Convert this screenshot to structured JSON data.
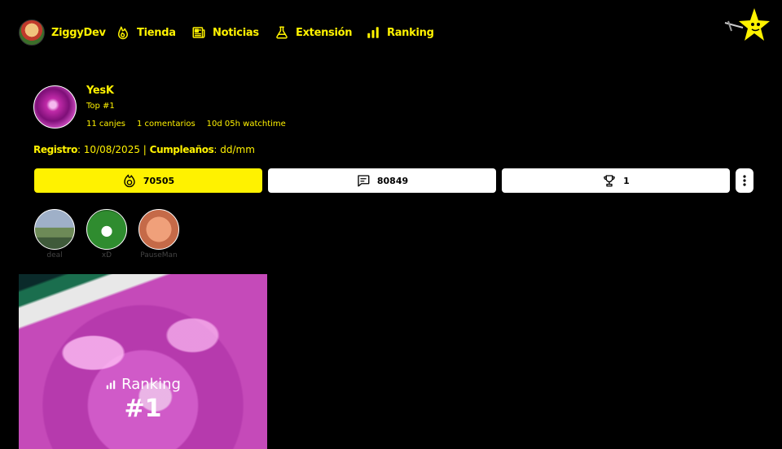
{
  "nav": {
    "user_name": "ZiggyDev",
    "items": [
      {
        "label": "Tienda",
        "icon": "fire-icon"
      },
      {
        "label": "Noticias",
        "icon": "newspaper-icon"
      },
      {
        "label": "Extensión",
        "icon": "flask-icon"
      },
      {
        "label": "Ranking",
        "icon": "bar-chart-icon"
      }
    ]
  },
  "profile": {
    "name": "YesK",
    "rank": "Top #1",
    "stats": [
      "11 canjes",
      "1 comentarios",
      "10d 05h watchtime"
    ],
    "registro_label": "Registro",
    "registro_value": ": 10/08/2025 |",
    "cumple_label": "Cumpleaños",
    "cumple_value": ": dd/mm"
  },
  "stats_buttons": {
    "points": "70505",
    "messages": "80849",
    "trophies": "1"
  },
  "emotes": [
    {
      "label": "deal"
    },
    {
      "label": "xD"
    },
    {
      "label": "PauseMan"
    }
  ],
  "card": {
    "ranking_label": "Ranking",
    "rank_number": "#1"
  },
  "colors": {
    "accent": "#fff200",
    "background": "#000000"
  }
}
